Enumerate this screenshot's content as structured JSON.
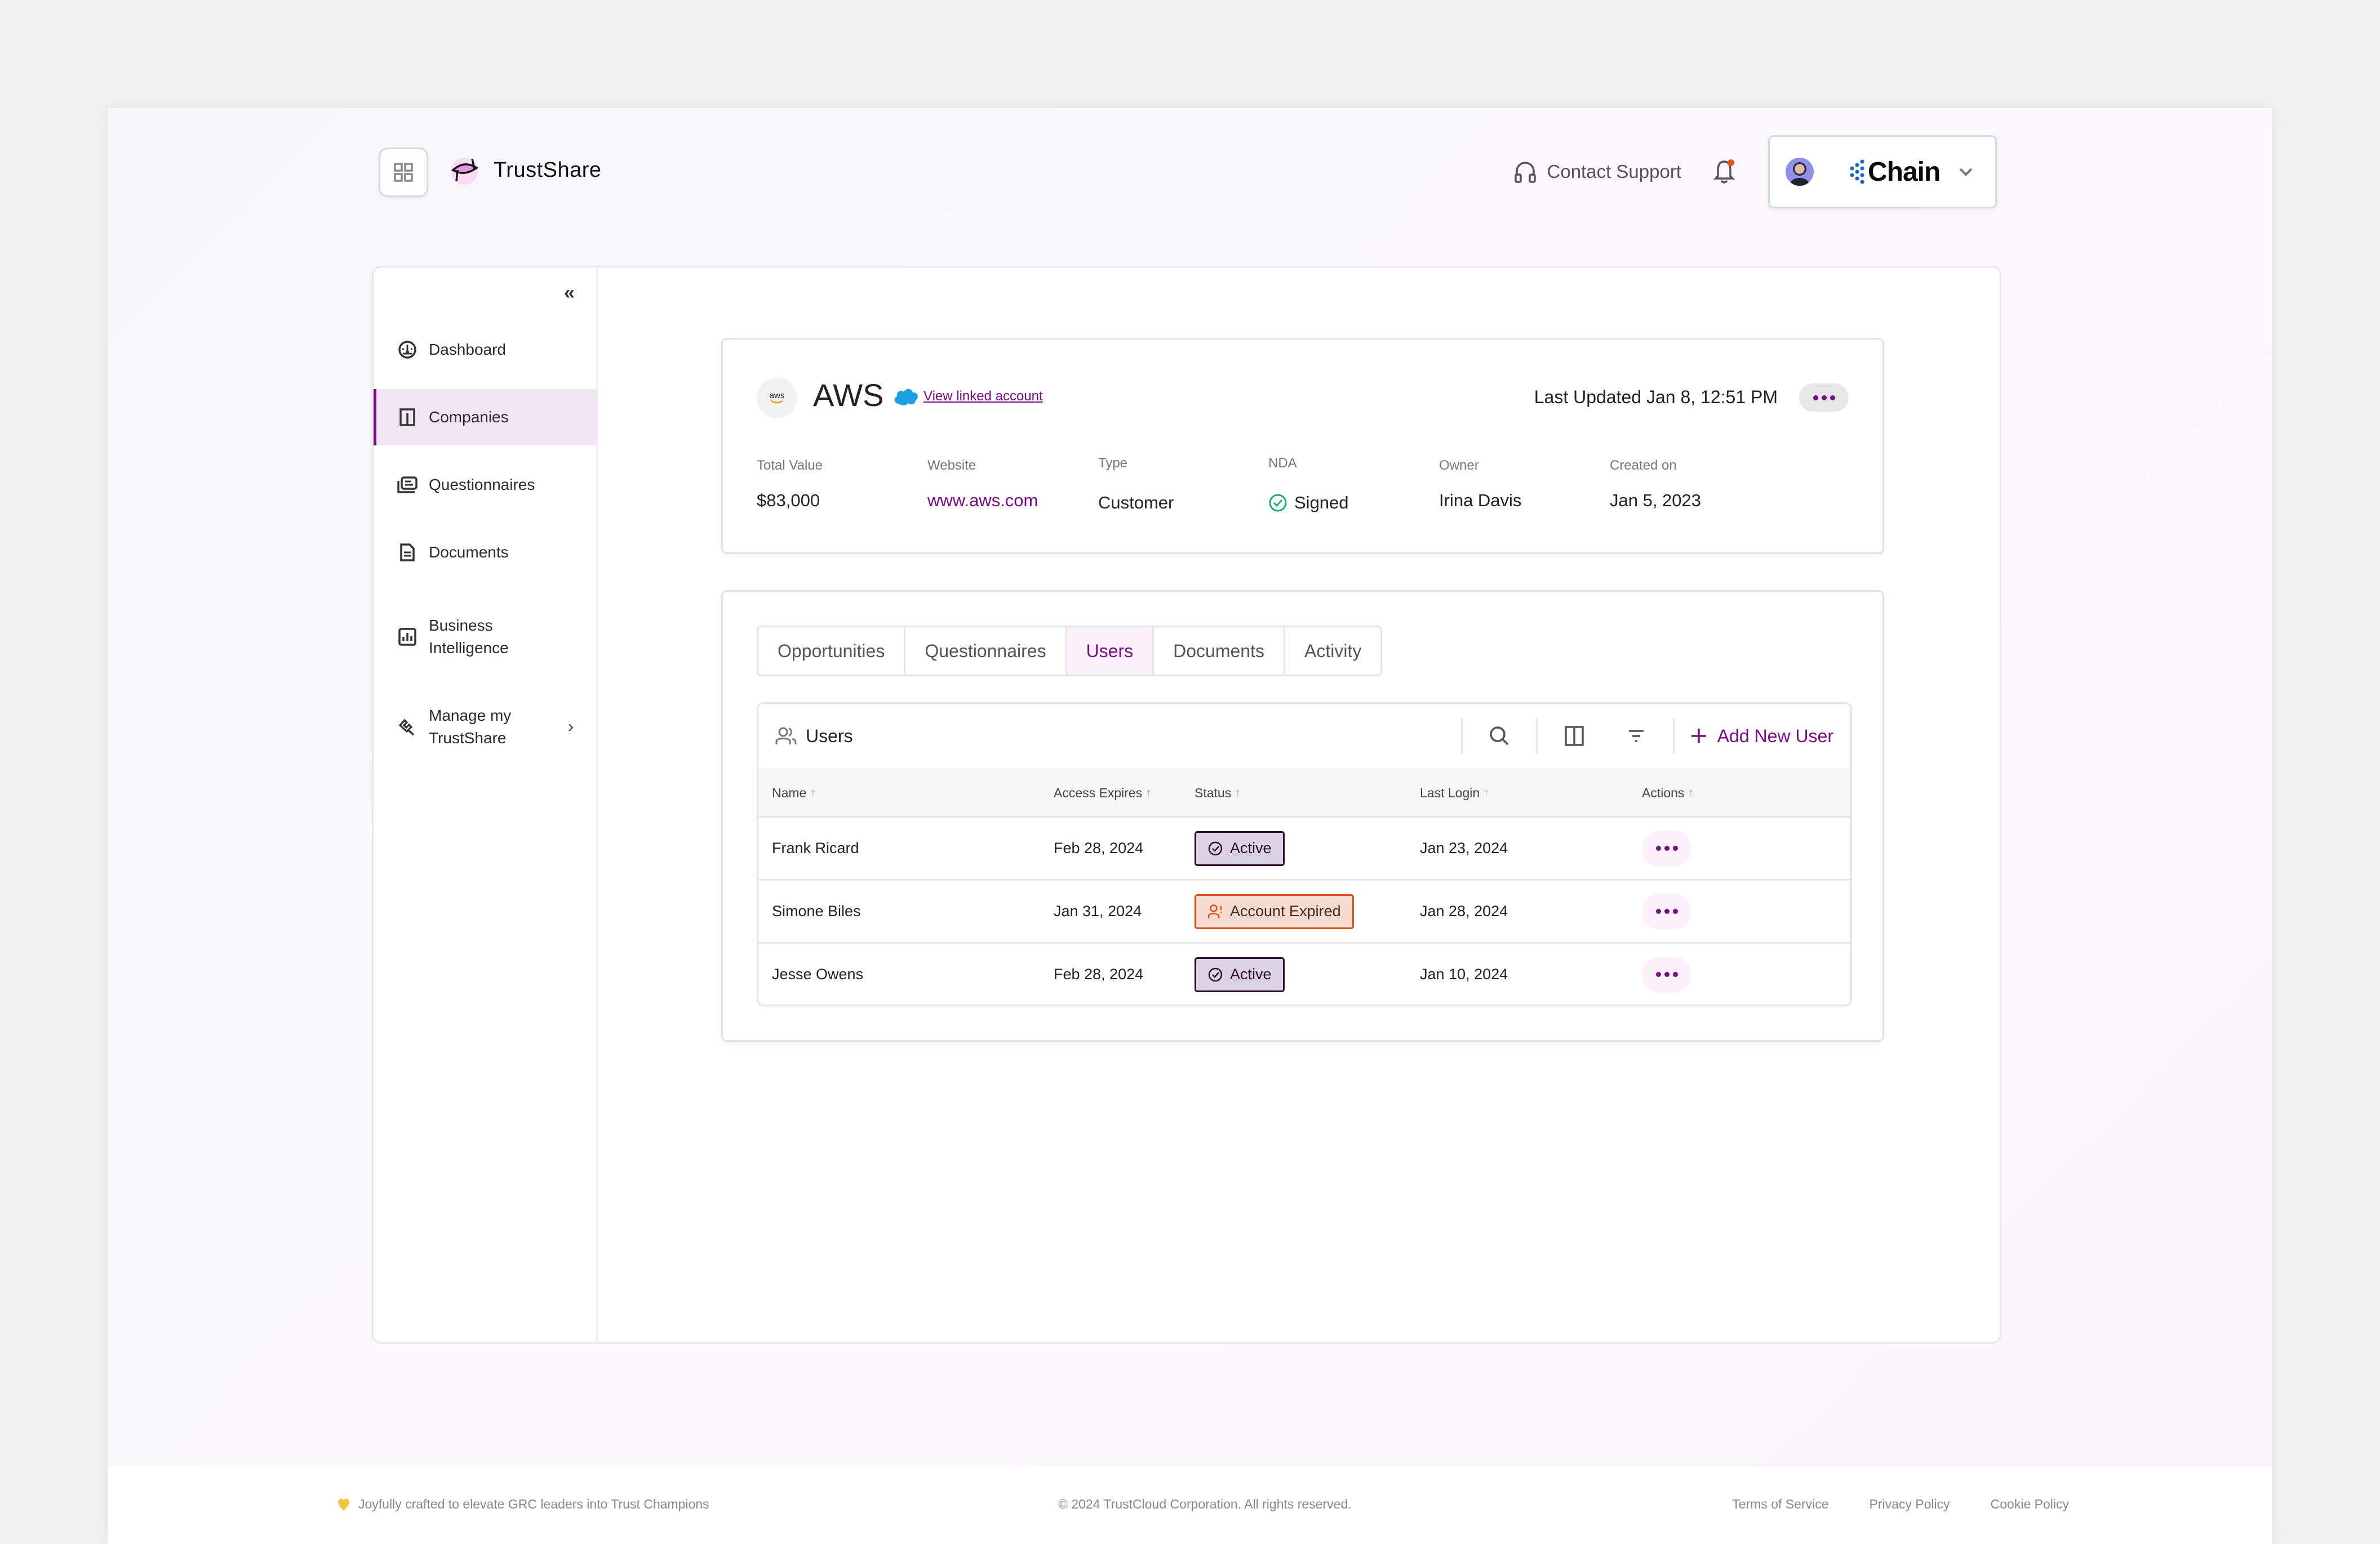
{
  "header": {
    "app_name": "TrustShare",
    "contact_support": "Contact Support",
    "org_name": "Chain"
  },
  "sidebar": {
    "items": [
      {
        "label": "Dashboard"
      },
      {
        "label": "Companies",
        "active": true
      },
      {
        "label": "Questionnaires"
      },
      {
        "label": "Documents"
      },
      {
        "label": "Business Intelligence"
      },
      {
        "label": "Manage my TrustShare"
      }
    ]
  },
  "company": {
    "logo_text": "aws",
    "name": "AWS",
    "linked_account": "View linked account",
    "last_updated": "Last Updated Jan 8, 12:51 PM",
    "fields": [
      {
        "label": "Total Value",
        "value": "$83,000"
      },
      {
        "label": "Website",
        "value": "www.aws.com"
      },
      {
        "label": "Type",
        "value": "Customer"
      },
      {
        "label": "NDA",
        "value": "Signed"
      },
      {
        "label": "Owner",
        "value": "Irina Davis"
      },
      {
        "label": "Created on",
        "value": "Jan 5, 2023"
      }
    ]
  },
  "tabs": [
    {
      "label": "Opportunities"
    },
    {
      "label": "Questionnaires"
    },
    {
      "label": "Users",
      "active": true
    },
    {
      "label": "Documents"
    },
    {
      "label": "Activity"
    }
  ],
  "users_table": {
    "title": "Users",
    "add_button": "Add New User",
    "columns": [
      "Name",
      "Access Expires",
      "Status",
      "Last Login",
      "Actions"
    ],
    "rows": [
      {
        "name": "Frank Ricard",
        "access_expires": "Feb 28, 2024",
        "status": "Active",
        "last_login": "Jan 23, 2024"
      },
      {
        "name": "Simone Biles",
        "access_expires": "Jan 31, 2024",
        "status": "Account Expired",
        "last_login": "Jan 28, 2024"
      },
      {
        "name": "Jesse Owens",
        "access_expires": "Feb 28, 2024",
        "status": "Active",
        "last_login": "Jan 10, 2024"
      }
    ]
  },
  "footer": {
    "tagline": "Joyfully crafted to elevate GRC leaders into Trust Champions",
    "copyright": "© 2024 TrustCloud Corporation. All rights reserved.",
    "links": [
      "Terms of Service",
      "Privacy Policy",
      "Cookie Policy"
    ]
  },
  "colors": {
    "accent": "#7b0a85",
    "active_nav_bg": "#f2e6f4",
    "expired_border": "#d9531e",
    "nda_check": "#1aaa7a"
  }
}
